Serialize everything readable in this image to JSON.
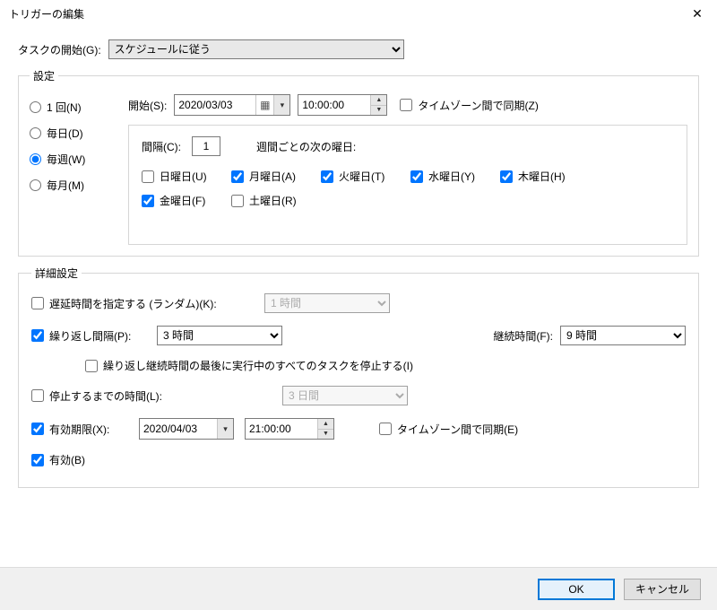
{
  "window": {
    "title": "トリガーの編集"
  },
  "taskStart": {
    "label": "タスクの開始(G):",
    "value": "スケジュールに従う"
  },
  "settings": {
    "legend": "設定",
    "freq": {
      "once": {
        "label": "1 回(N)",
        "checked": false
      },
      "daily": {
        "label": "毎日(D)",
        "checked": false
      },
      "weekly": {
        "label": "毎週(W)",
        "checked": true
      },
      "monthly": {
        "label": "毎月(M)",
        "checked": false
      }
    },
    "start": {
      "label": "開始(S):",
      "date": "2020/03/03",
      "time": "10:00:00",
      "tzSync": {
        "label": "タイムゾーン間で同期(Z)",
        "checked": false
      }
    },
    "weekly": {
      "intervalLabel": "間隔(C):",
      "intervalValue": "1",
      "daysLabel": "週間ごとの次の曜日:",
      "days": {
        "sun": {
          "label": "日曜日(U)",
          "checked": false
        },
        "mon": {
          "label": "月曜日(A)",
          "checked": true
        },
        "tue": {
          "label": "火曜日(T)",
          "checked": true
        },
        "wed": {
          "label": "水曜日(Y)",
          "checked": true
        },
        "thu": {
          "label": "木曜日(H)",
          "checked": true
        },
        "fri": {
          "label": "金曜日(F)",
          "checked": true
        },
        "sat": {
          "label": "土曜日(R)",
          "checked": false
        }
      }
    }
  },
  "advanced": {
    "legend": "詳細設定",
    "delay": {
      "label": "遅延時間を指定する (ランダム)(K):",
      "checked": false,
      "value": "1 時間"
    },
    "repeat": {
      "label": "繰り返し間隔(P):",
      "checked": true,
      "value": "3 時間",
      "durationLabel": "継続時間(F):",
      "durationValue": "9 時間"
    },
    "stopAtEnd": {
      "label": "繰り返し継続時間の最後に実行中のすべてのタスクを停止する(I)",
      "checked": false
    },
    "stopAfter": {
      "label": "停止するまでの時間(L):",
      "checked": false,
      "value": "3 日間"
    },
    "expire": {
      "label": "有効期限(X):",
      "checked": true,
      "date": "2020/04/03",
      "time": "21:00:00",
      "tzSync": {
        "label": "タイムゾーン間で同期(E)",
        "checked": false
      }
    },
    "enabled": {
      "label": "有効(B)",
      "checked": true
    }
  },
  "buttons": {
    "ok": "OK",
    "cancel": "キャンセル"
  }
}
